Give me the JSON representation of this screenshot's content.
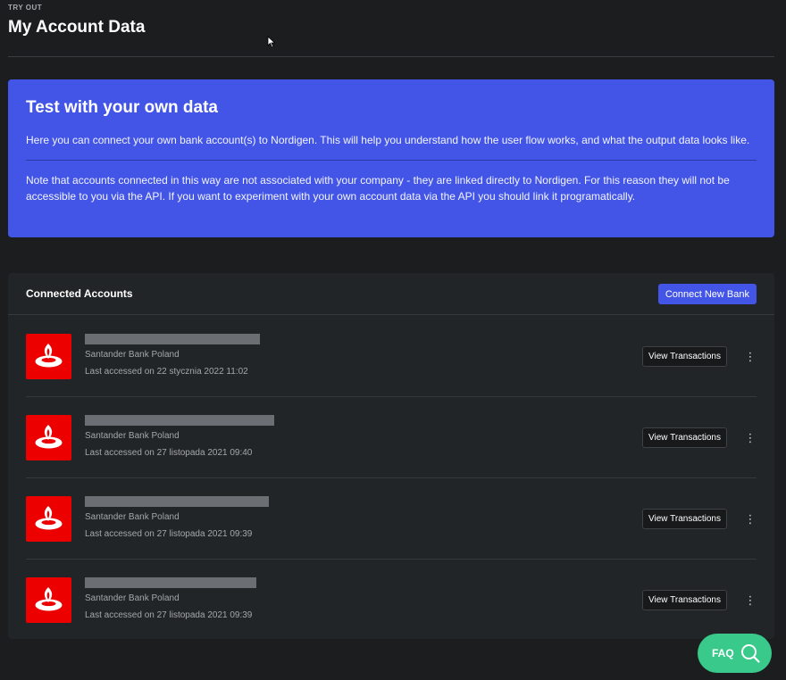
{
  "header": {
    "eyebrow": "TRY OUT",
    "title": "My Account Data"
  },
  "info": {
    "title": "Test with your own data",
    "text1": "Here you can connect your own bank account(s) to Nordigen. This will help you understand how the user flow works, and what the output data looks like.",
    "text2": "Note that accounts connected in this way are not associated with your company - they are linked directly to Nordigen. For this reason they will not be accessible to you via the API. If you want to experiment with your own account data via the API you should link it programatically."
  },
  "accounts": {
    "title": "Connected Accounts",
    "connect_label": "Connect New Bank",
    "view_label": "View Transactions",
    "items": [
      {
        "bank": "Santander Bank Poland",
        "last_accessed": "Last accessed on 22 stycznia 2022 11:02"
      },
      {
        "bank": "Santander Bank Poland",
        "last_accessed": "Last accessed on 27 listopada 2021 09:40"
      },
      {
        "bank": "Santander Bank Poland",
        "last_accessed": "Last accessed on 27 listopada 2021 09:39"
      },
      {
        "bank": "Santander Bank Poland",
        "last_accessed": "Last accessed on 27 listopada 2021 09:39"
      }
    ]
  },
  "faq": {
    "label": "FAQ"
  },
  "icons": {
    "bank_logo": "santander-flame-icon",
    "menu": "kebab-menu-icon",
    "faq": "search-icon",
    "cursor": "mouse-pointer-icon"
  },
  "colors": {
    "background": "#1b1d1f",
    "accent": "#4255e6",
    "card": "#222527",
    "bank_red": "#ec0000",
    "faq_green": "#38c98b"
  }
}
